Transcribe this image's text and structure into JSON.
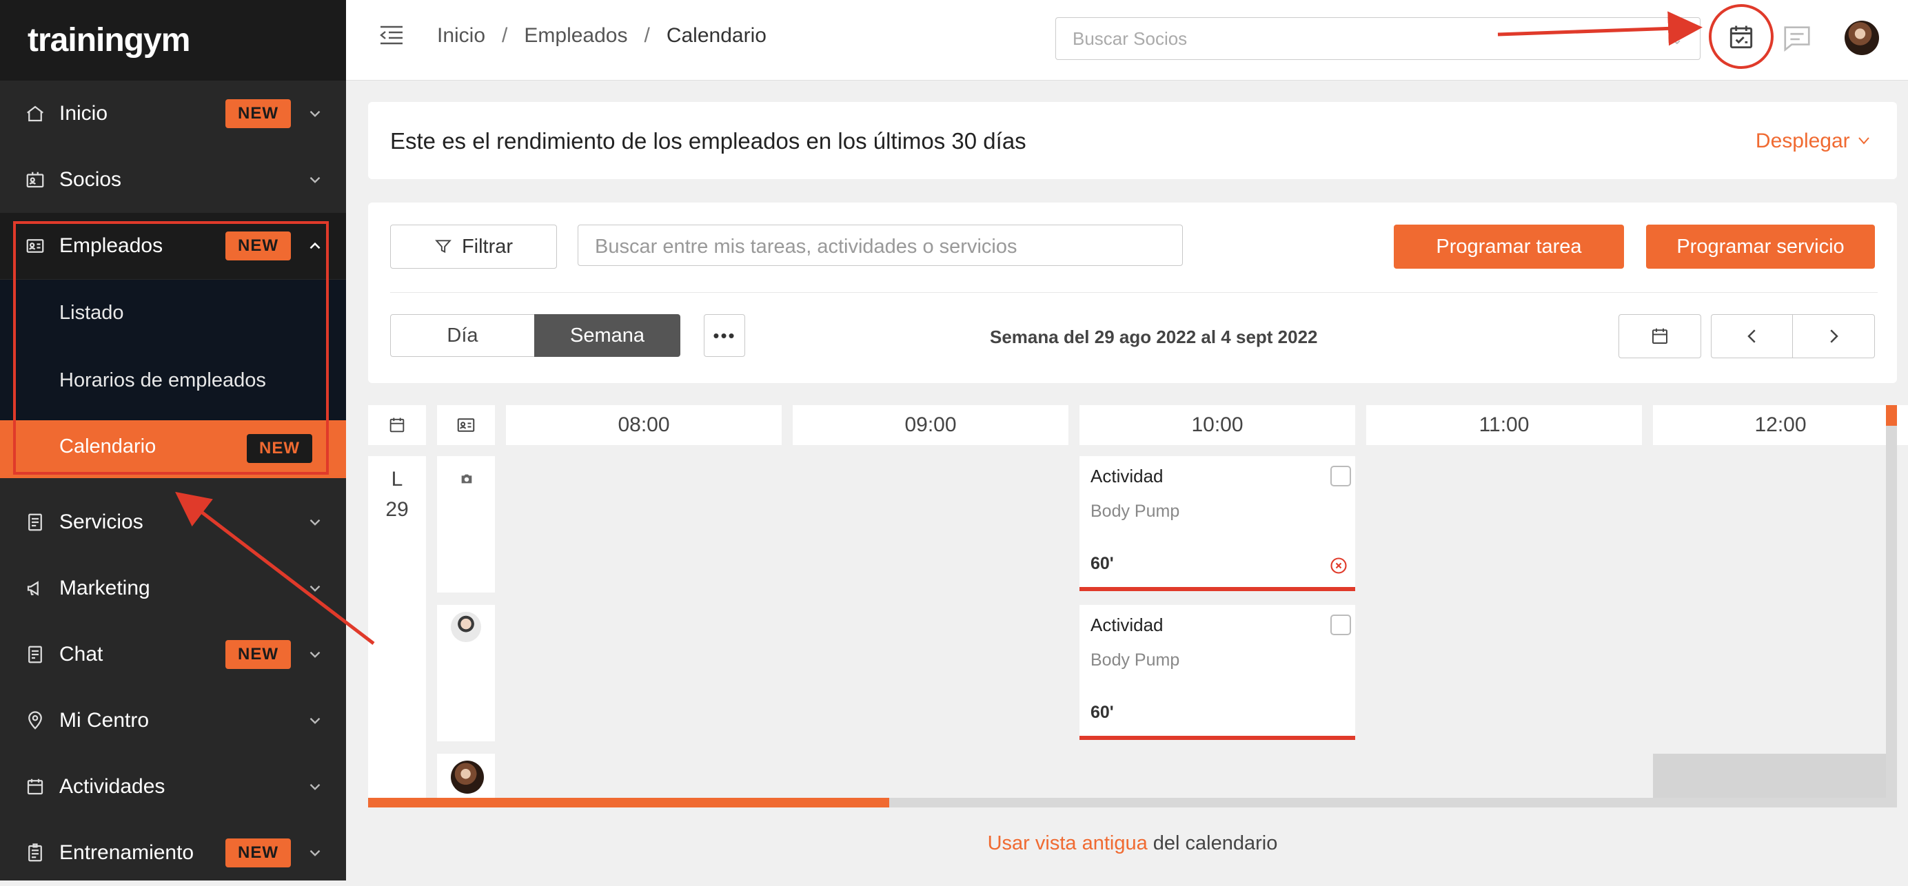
{
  "brand": "trainingym",
  "sidebar": {
    "items": [
      {
        "label": "Inicio",
        "badge": "NEW",
        "icon": "home-icon"
      },
      {
        "label": "Socios",
        "badge": "",
        "icon": "id-card-icon"
      },
      {
        "label": "Empleados",
        "badge": "NEW",
        "icon": "employee-card-icon"
      },
      {
        "label": "Servicios",
        "badge": "",
        "icon": "document-icon"
      },
      {
        "label": "Marketing",
        "badge": "",
        "icon": "megaphone-icon"
      },
      {
        "label": "Chat",
        "badge": "NEW",
        "icon": "chat-document-icon"
      },
      {
        "label": "Mi Centro",
        "badge": "",
        "icon": "location-pin-icon"
      },
      {
        "label": "Actividades",
        "badge": "",
        "icon": "calendar-icon"
      },
      {
        "label": "Entrenamiento",
        "badge": "NEW",
        "icon": "clipboard-icon"
      }
    ],
    "sub_items": [
      "Listado",
      "Horarios de empleados",
      "Calendario"
    ],
    "selected_badge": "NEW"
  },
  "header": {
    "breadcrumb": [
      "Inicio",
      "Empleados",
      "Calendario"
    ],
    "search_placeholder": "Buscar Socios"
  },
  "performance": {
    "title": "Este es el rendimiento de los empleados en los últimos 30 días",
    "expand_label": "Desplegar"
  },
  "toolbar": {
    "filter_label": "Filtrar",
    "search_placeholder": "Buscar entre mis tareas, actividades o servicios",
    "schedule_task": "Programar tarea",
    "schedule_service": "Programar servicio",
    "view_day": "Día",
    "view_week": "Semana",
    "active_view": "Semana",
    "week_label": "Semana del 29 ago 2022 al 4 sept 2022"
  },
  "calendar": {
    "hours": [
      "08:00",
      "09:00",
      "10:00",
      "11:00",
      "12:00"
    ],
    "day_letter": "L",
    "day_number": "29",
    "events": [
      {
        "type": "Actividad",
        "name": "Body Pump",
        "duration": "60'",
        "cancelled": true
      },
      {
        "type": "Actividad",
        "name": "Body Pump",
        "duration": "60'",
        "cancelled": false
      }
    ]
  },
  "footer": {
    "link": "Usar vista antigua",
    "text": " del calendario"
  },
  "colors": {
    "accent": "#f06a31",
    "sidebar_bg": "#282828",
    "annotation": "#e03a2a"
  }
}
